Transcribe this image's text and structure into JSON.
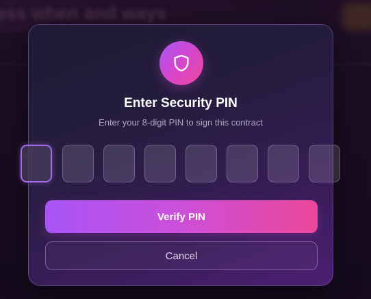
{
  "background": {
    "heading_text": "ess when and ways"
  },
  "modal": {
    "icon": "shield-icon",
    "title": "Enter Security PIN",
    "subtitle": "Enter your 8-digit PIN to sign this contract",
    "pin": {
      "length": 8,
      "active_index": 0,
      "digits": [
        "",
        "",
        "",
        "",
        "",
        "",
        "",
        ""
      ]
    },
    "verify_label": "Verify PIN",
    "cancel_label": "Cancel"
  },
  "colors": {
    "accent_start": "#a855f7",
    "accent_end": "#ec4899",
    "modal_border": "#a46be6"
  }
}
